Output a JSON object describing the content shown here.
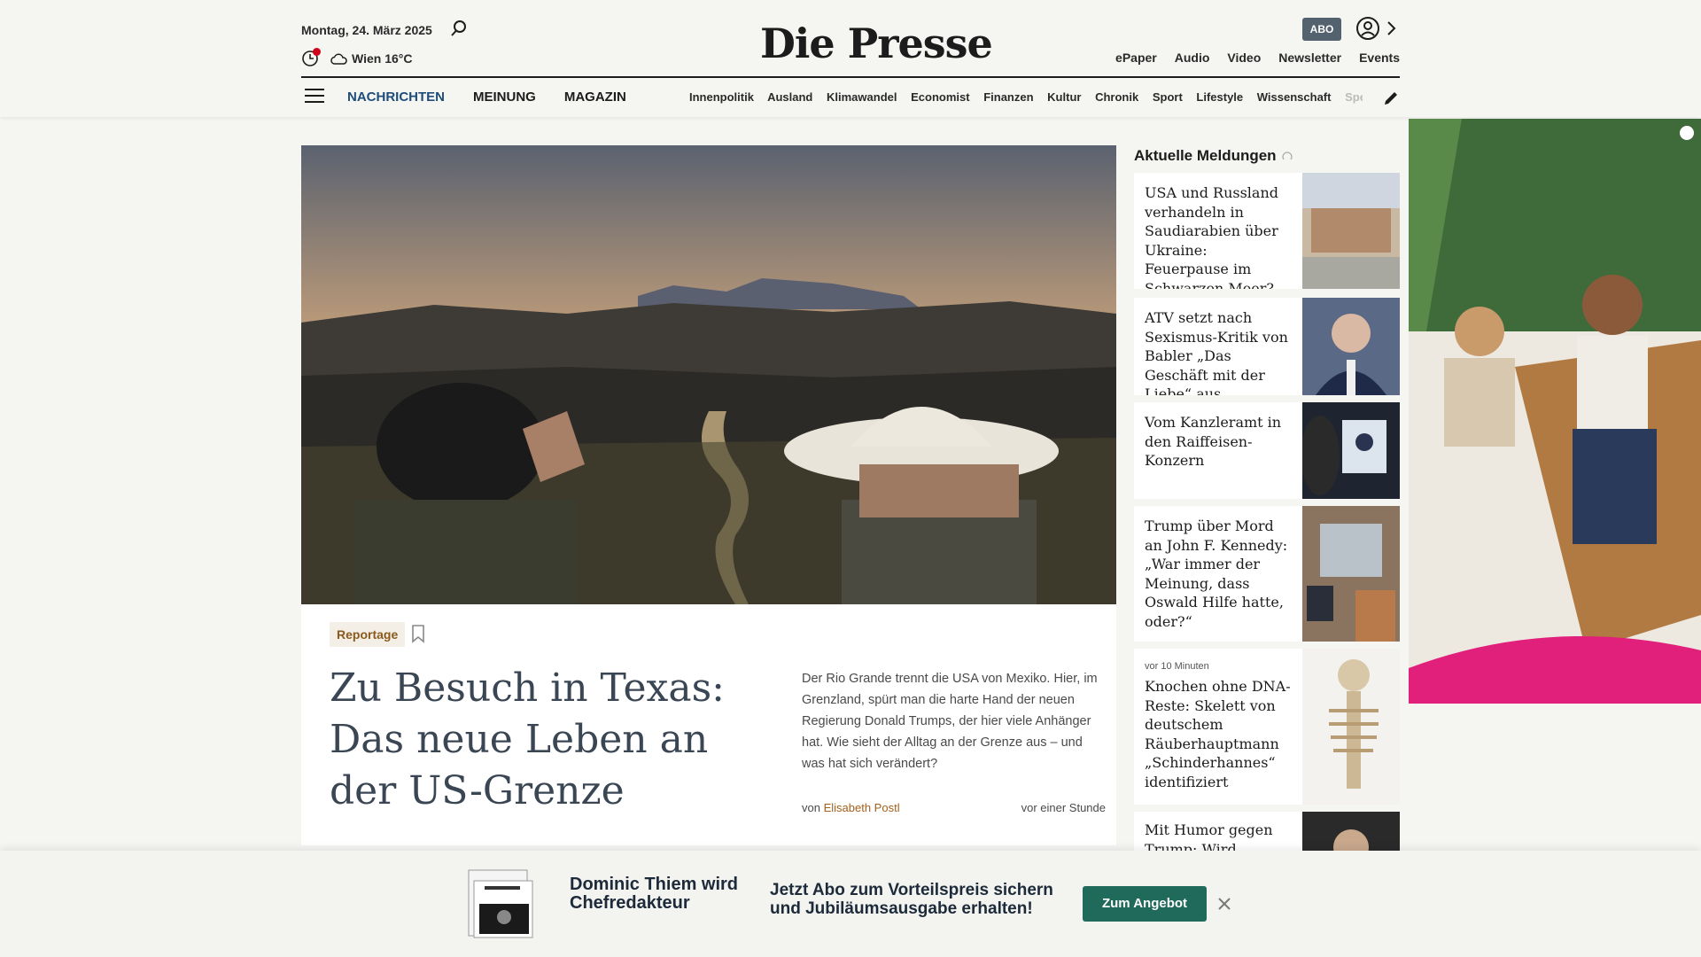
{
  "header": {
    "date": "Montag, 24. März 2025",
    "weather": "Wien 16°C",
    "logo": "Die Presse",
    "abo_label": "ABO",
    "top_links": [
      "ePaper",
      "Audio",
      "Video",
      "Newsletter",
      "Events"
    ],
    "main_nav": [
      "NACHRICHTEN",
      "MEINUNG",
      "MAGAZIN"
    ],
    "sub_nav": [
      "Innenpolitik",
      "Ausland",
      "Klimawandel",
      "Economist",
      "Finanzen",
      "Kultur",
      "Chronik",
      "Sport",
      "Lifestyle",
      "Wissenschaft",
      "Spectrum"
    ]
  },
  "hero": {
    "tag": "Reportage",
    "headline": "Zu Besuch in Texas: Das neue Leben an der US-Grenze",
    "teaser": "Der Rio Grande trennt die USA von Mexiko. Hier, im Grenzland, spürt man die harte Hand der neuen Regierung Donald Trumps, der hier viele Anhänger hat. Wie sieht der Alltag an der Grenze aus – und was hat sich verändert?",
    "byline_prefix": "von",
    "author": "Elisabeth Postl",
    "time": "vor einer Stunde"
  },
  "sidebar": {
    "title": "Aktuelle Meldungen",
    "items": [
      {
        "text": "USA und Russland verhandeln in Saudiarabien über Ukraine: Feuerpause im Schwarzen Meer?",
        "meta": ""
      },
      {
        "text": "ATV setzt nach Sexismus-Kritik von Babler „Das Geschäft mit der Liebe“ aus",
        "meta": ""
      },
      {
        "text": "Vom Kanzleramt in den Raiffeisen-Konzern",
        "meta": ""
      },
      {
        "text": "Trump über Mord an John F. Kennedy: „War immer der Meinung, dass Oswald Hilfe hatte, oder?“",
        "meta": ""
      },
      {
        "text": "Knochen ohne DNA-Reste: Skelett von deutschem Räuberhauptmann „Schinderhannes“ identifiziert",
        "meta": "vor 10 Minuten"
      },
      {
        "text": "Mit Humor gegen Trump: Wird",
        "meta": ""
      }
    ]
  },
  "banner": {
    "title": "Dominic Thiem wird Chefredakteur",
    "offer": "Jetzt Abo zum Vorteilspreis sichern und Jubiläumsausgabe erhalten!",
    "button": "Zum Angebot"
  }
}
